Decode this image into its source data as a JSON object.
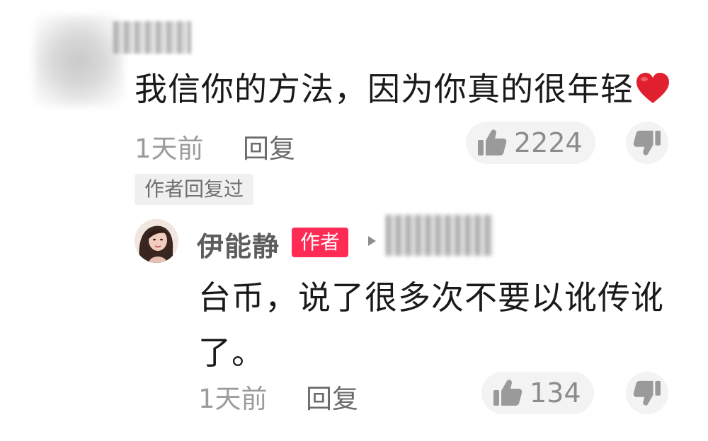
{
  "comment": {
    "text": "我信你的方法，因为你真的很年轻",
    "heart_icon": "red-heart-emoji",
    "time": "1天前",
    "reply_label": "回复",
    "like_count": "2224",
    "author_replied_tag": "作者回复过"
  },
  "reply": {
    "author_name": "伊能静",
    "author_badge": "作者",
    "text": "台币，说了很多次不要以讹传讹了。",
    "time": "1天前",
    "reply_label": "回复",
    "like_count": "134"
  },
  "colors": {
    "badge": "#fe2c55",
    "heart": "#e0202e",
    "muted_text": "#9b9b9b"
  }
}
